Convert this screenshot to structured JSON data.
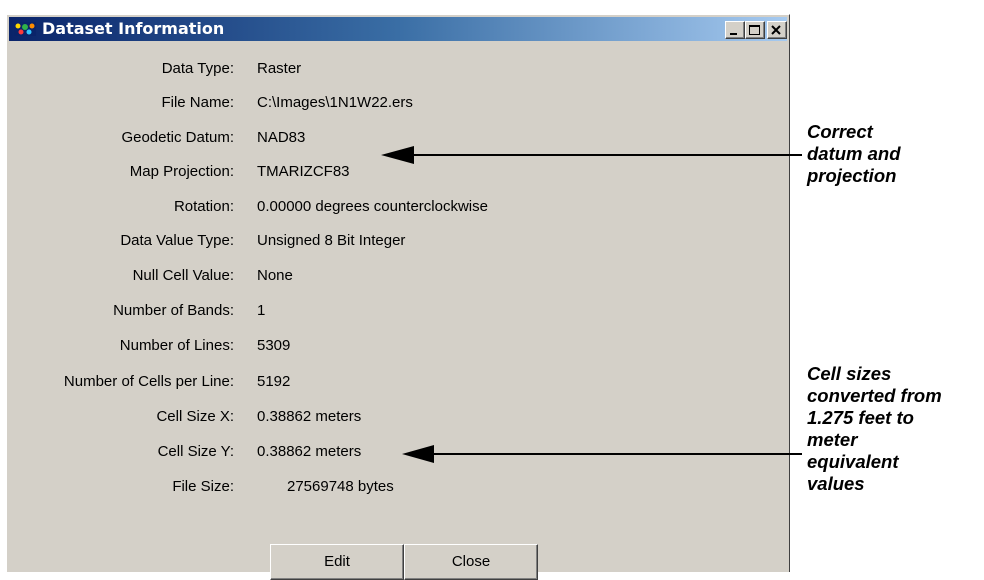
{
  "window": {
    "title": "Dataset Information",
    "controls": {
      "minimize_icon": "minimize-icon",
      "maximize_icon": "maximize-icon",
      "close_icon": "close-icon"
    }
  },
  "fields": [
    {
      "label": "Data Type:",
      "value": "Raster"
    },
    {
      "label": "File Name:",
      "value": "C:\\Images\\1N1W22.ers"
    },
    {
      "label": "Geodetic Datum:",
      "value": "NAD83"
    },
    {
      "label": "Map Projection:",
      "value": "TMARIZCF83"
    },
    {
      "label": "Rotation:",
      "value": "0.00000 degrees counterclockwise"
    },
    {
      "label": "Data Value Type:",
      "value": "Unsigned 8 Bit Integer"
    },
    {
      "label": "Null Cell Value:",
      "value": "None"
    },
    {
      "label": "Number of Bands:",
      "value": "1"
    },
    {
      "label": "Number of Lines:",
      "value": "5309"
    },
    {
      "label": "Number of Cells per Line:",
      "value": "5192"
    },
    {
      "label": "Cell Size X:",
      "value": "0.38862 meters"
    },
    {
      "label": "Cell Size Y:",
      "value": "0.38862 meters"
    },
    {
      "label": "File Size:",
      "value": "27569748 bytes"
    }
  ],
  "buttons": {
    "edit": "Edit",
    "close": "Close"
  },
  "annotations": {
    "datum": "Correct\ndatum and\nprojection",
    "cell_size": "Cell sizes\nconverted from\n1.275 feet to\nmeter\nequivalent\nvalues"
  },
  "colors": {
    "title_gradient_start": "#0a246a",
    "title_gradient_end": "#a6caf0",
    "dialog_face": "#d4d0c8"
  }
}
